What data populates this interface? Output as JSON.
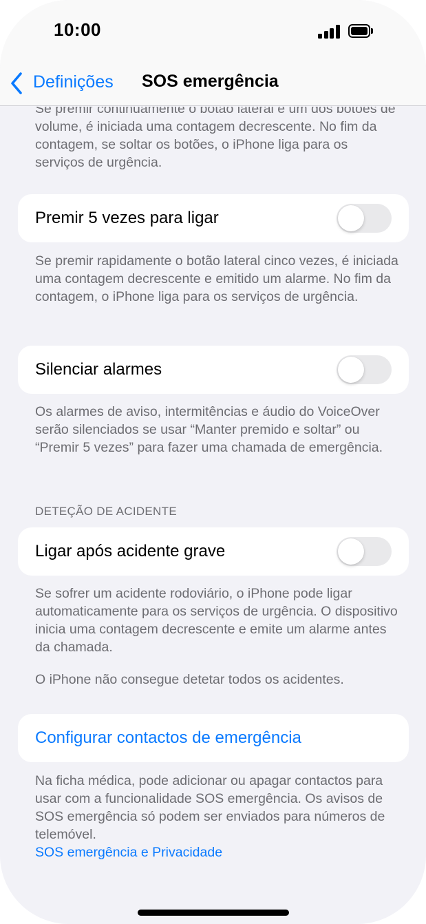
{
  "status_bar": {
    "time": "10:00"
  },
  "nav": {
    "back_label": "Definições",
    "title": "SOS emergência"
  },
  "sections": {
    "top_footer": "Se premir continuamente o botão lateral e um dos botões de volume, é iniciada uma contagem decrescente. No fim da contagem, se soltar os botões, o iPhone liga para os serviços de urgência.",
    "press5": {
      "label": "Premir 5 vezes para ligar",
      "enabled": false,
      "footer": "Se premir rapidamente o botão lateral cinco vezes, é iniciada uma contagem decrescente e emitido um alarme. No fim da contagem, o iPhone liga para os serviços de urgência."
    },
    "silence": {
      "label": "Silenciar alarmes",
      "enabled": false,
      "footer": "Os alarmes de aviso, intermitências e áudio do VoiceOver serão silenciados se usar “Manter premido e soltar” ou “Premir 5 vezes” para fazer uma chamada de emergência."
    },
    "crash": {
      "header": "DETEÇÃO DE ACIDENTE",
      "label": "Ligar após acidente grave",
      "enabled": false,
      "footer": "Se sofrer um acidente rodoviário, o iPhone pode ligar automaticamente para os serviços de urgência. O dispositivo inicia uma contagem decrescente e emite um alarme antes da chamada.",
      "footer_note": "O iPhone não consegue detetar todos os acidentes."
    },
    "contacts": {
      "label": "Configurar contactos de emergência",
      "footer": "Na ficha médica, pode adicionar ou apagar contactos para usar com a funcionalidade SOS emergência. Os avisos de SOS emergência só podem ser enviados para números de telemóvel.",
      "privacy_link": "SOS emergência e Privacidade"
    }
  },
  "colors": {
    "accent": "#0a7aff",
    "background": "#f2f2f7",
    "secondary_text": "#6d6d72",
    "toggle_off": "#e9e9eb"
  },
  "icons": {
    "back": "chevron-left-icon",
    "signal": "cellular-signal-icon",
    "battery": "battery-icon"
  }
}
